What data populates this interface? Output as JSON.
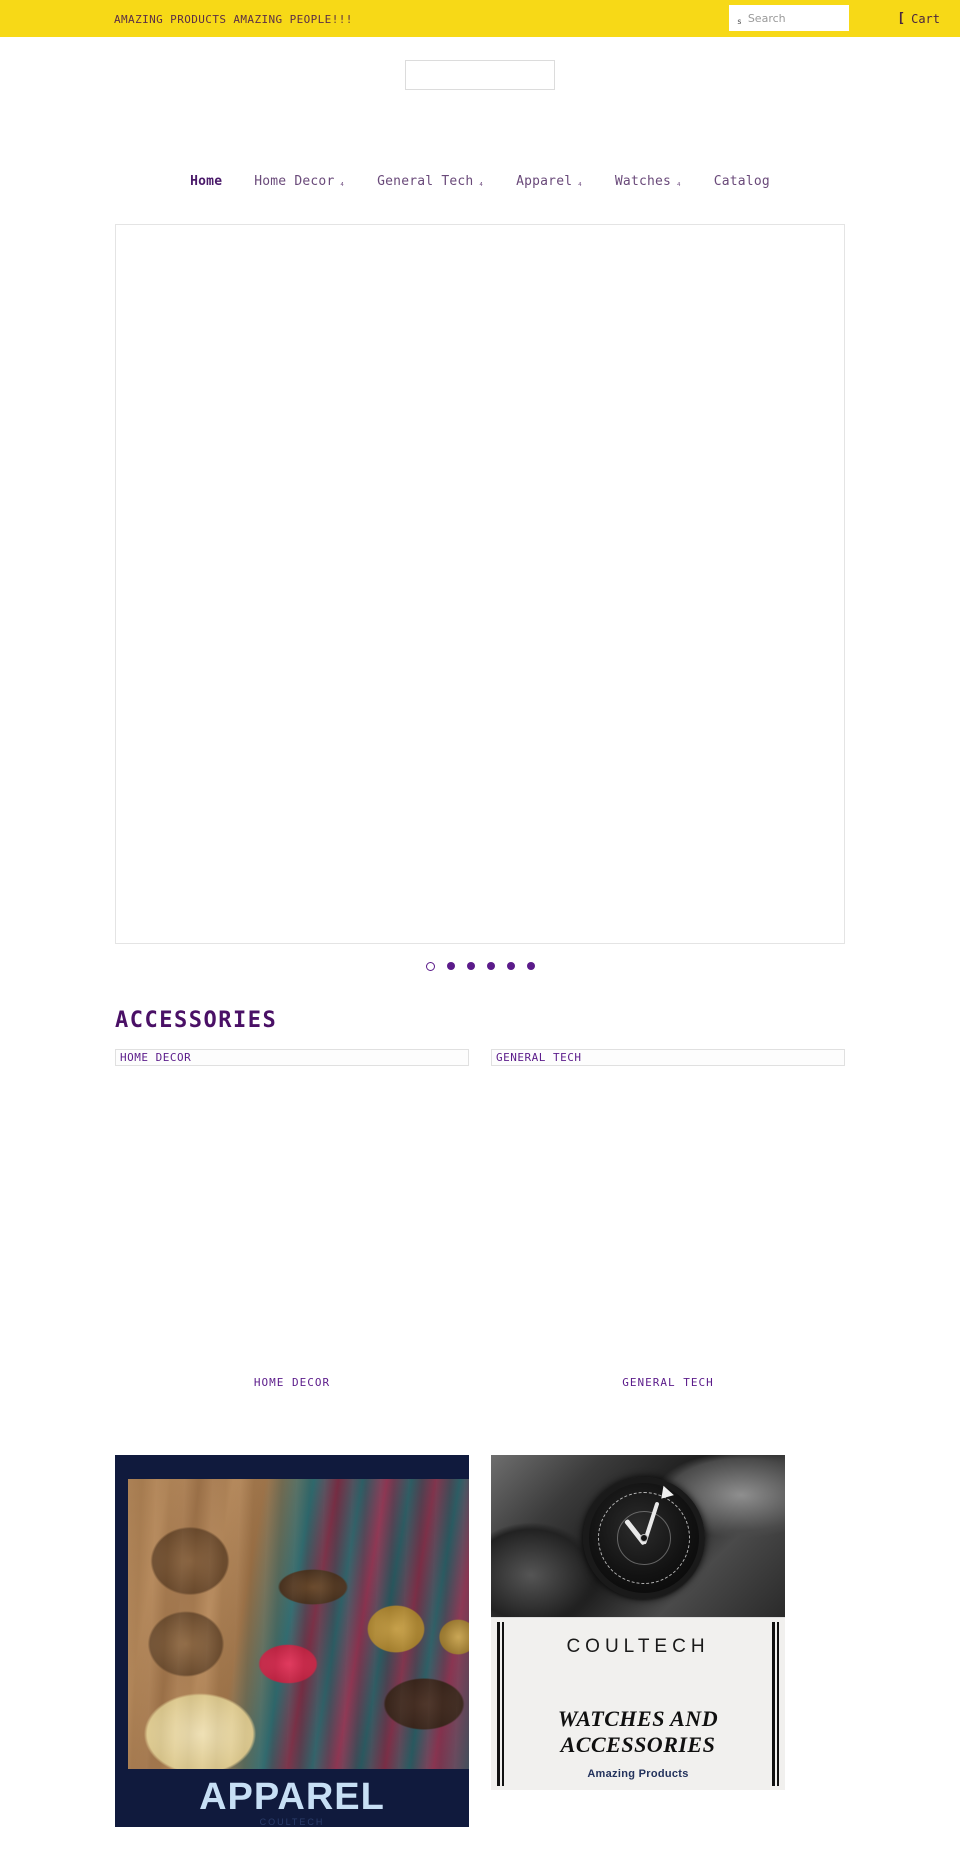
{
  "announcement": {
    "text": "AMAZING PRODUCTS AMAZING PEOPLE!!!"
  },
  "utility": {
    "cart_icon": "cart-icon",
    "cart_label": "Cart",
    "search_icon": "search-icon",
    "search_placeholder": "Search",
    "search_value": ""
  },
  "brandbar": {
    "logo_alt": ""
  },
  "nav": {
    "items": [
      {
        "label": "Home",
        "active": true,
        "caret": ""
      },
      {
        "label": "Home Decor",
        "active": false,
        "caret": "₄"
      },
      {
        "label": "General Tech",
        "active": false,
        "caret": "₄"
      },
      {
        "label": "Apparel",
        "active": false,
        "caret": "₄"
      },
      {
        "label": "Watches",
        "active": false,
        "caret": "₄"
      },
      {
        "label": "Catalog",
        "active": false,
        "caret": ""
      }
    ]
  },
  "hero": {
    "slide_alt": "",
    "dots_total": 6,
    "dot_active_index": 0
  },
  "accessories": {
    "title": "ACCESSORIES",
    "collections": [
      {
        "alt_text": "HOME DECOR",
        "label": "HOME DECOR"
      },
      {
        "alt_text": "GENERAL TECH",
        "label": "GENERAL TECH"
      }
    ]
  },
  "banners": {
    "apparel": {
      "title": "APPAREL",
      "subtitle": "COULTECH"
    },
    "watches": {
      "brand": "COULTECH",
      "tagline": "WATCHES AND ACCESSORIES",
      "sub": "Amazing Products"
    }
  },
  "colors": {
    "announce_bg": "#f7d917",
    "accent_purple": "#5b1b8a",
    "nav_text": "#6a4a7a",
    "apparel_bg": "#101a3d",
    "apparel_title": "#c7dff5"
  }
}
